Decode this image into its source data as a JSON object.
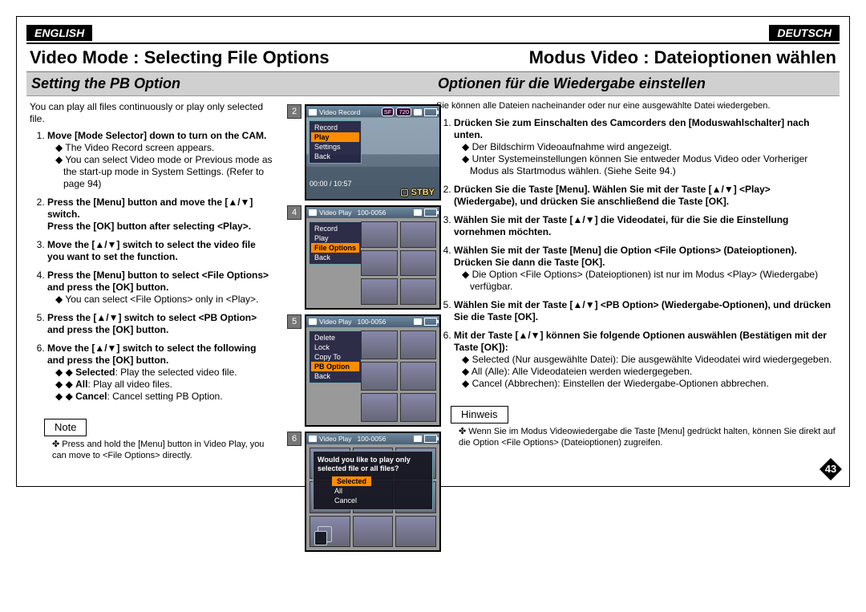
{
  "lang": {
    "en": "ENGLISH",
    "de": "DEUTSCH"
  },
  "title": {
    "en": "Video Mode : Selecting File Options",
    "de": "Modus Video : Dateioptionen wählen"
  },
  "subtitle": {
    "en": "Setting the PB Option",
    "de": "Optionen für die Wiedergabe einstellen"
  },
  "intro": {
    "en": "You can play all files continuously or play only selected file.",
    "de": "Sie können alle Dateien nacheinander oder nur eine ausgewählte Datei wiedergeben."
  },
  "en_steps": {
    "s1": "Move [Mode Selector] down to turn on the CAM.",
    "s1a": "The Video Record screen appears.",
    "s1b": "You can select Video mode or Previous mode as the start-up mode in System Settings. (Refer to page 94)",
    "s2": "Press the [Menu] button and move the [▲/▼] switch.",
    "s2a": "Press the [OK] button after selecting <Play>.",
    "s3": "Move the [▲/▼] switch to select the video file you want to set the function.",
    "s4": "Press the [Menu] button to select <File Options> and press the [OK] button.",
    "s4a": "You can select <File Options> only in <Play>.",
    "s5": "Press the [▲/▼] switch to select <PB Option> and press the [OK] button.",
    "s6": "Move the [▲/▼] switch to select the following and press the [OK] button.",
    "s6a": "Selected: Play the selected video file.",
    "s6a_label": "Selected",
    "s6b": "All: Play all video files.",
    "s6b_label": "All",
    "s6c": "Cancel: Cancel setting PB Option.",
    "s6c_label": "Cancel"
  },
  "en_note_title": "Note",
  "en_note": "Press and hold the [Menu] button in Video Play, you can move to <File Options> directly.",
  "de_steps": {
    "s1": "Drücken Sie zum Einschalten des Camcorders den [Moduswahlschalter] nach unten.",
    "s1a": "Der Bildschirm Videoaufnahme wird angezeigt.",
    "s1b": "Unter Systemeinstellungen können Sie entweder Modus Video oder Vorheriger Modus als Startmodus wählen. (Siehe Seite 94.)",
    "s2": "Drücken Sie die Taste [Menu]. Wählen Sie mit der Taste [▲/▼] <Play> (Wiedergabe), und drücken Sie anschließend die Taste [OK].",
    "s3": "Wählen Sie mit der Taste [▲/▼] die Videodatei, für die Sie die Einstellung vornehmen möchten.",
    "s4": "Wählen Sie mit der Taste [Menu] die Option <File Options> (Dateioptionen). Drücken Sie dann die Taste [OK].",
    "s4a": "Die Option <File Options> (Dateioptionen) ist nur im Modus <Play> (Wiedergabe) verfügbar.",
    "s5": "Wählen Sie mit der Taste [▲/▼] <PB Option> (Wiedergabe-Optionen), und drücken Sie die Taste [OK].",
    "s6": "Mit der Taste [▲/▼] können Sie folgende Optionen auswählen (Bestätigen mit der Taste [OK]):",
    "s6a": "Selected (Nur ausgewählte Datei): Die ausgewählte Videodatei wird wiedergegeben.",
    "s6b": "All (Alle): Alle Videodateien werden wiedergegeben.",
    "s6c": "Cancel (Abbrechen): Einstellen der Wiedergabe-Optionen abbrechen."
  },
  "de_note_title": "Hinweis",
  "de_note": "Wenn Sie im Modus Videowiedergabe die Taste [Menu] gedrückt halten, können Sie direkt auf die Option <File Options> (Dateioptionen) zugreifen.",
  "screens": {
    "s2": {
      "num": "2",
      "title": "Video Record",
      "badge_sf": "SF",
      "badge_res": "720",
      "menu": [
        "Record",
        "Play",
        "Settings",
        "Back"
      ],
      "highlight": "Play",
      "time": "00:00 / 10:57",
      "stby": "STBY"
    },
    "s4": {
      "num": "4",
      "title": "Video Play",
      "file": "100-0056",
      "menu": [
        "Record",
        "Play",
        "File Options",
        "Back"
      ],
      "highlight": "File Options"
    },
    "s5": {
      "num": "5",
      "title": "Video Play",
      "file": "100-0056",
      "menu": [
        "Delete",
        "Lock",
        "Copy To",
        "PB Option",
        "Back"
      ],
      "highlight": "PB Option"
    },
    "s6": {
      "num": "6",
      "title": "Video Play",
      "file": "100-0056",
      "question": "Would you like to play only selected file or all files?",
      "options": [
        "Selected",
        "All",
        "Cancel"
      ],
      "highlight": "Selected"
    }
  },
  "page_number": "43"
}
